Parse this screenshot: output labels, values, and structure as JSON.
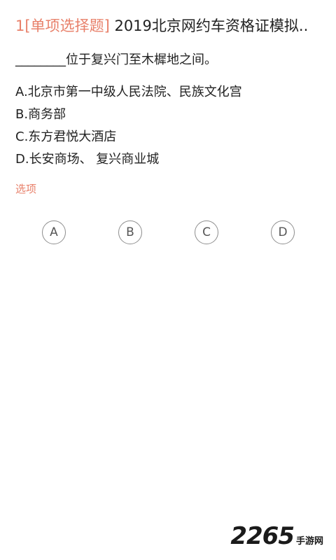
{
  "header": {
    "number": "1",
    "type": "[单项选择题]",
    "title": "2019北京网约车资格证模拟.."
  },
  "question": {
    "text": "________位于复兴门至木樨地之间。"
  },
  "options": [
    {
      "text": "A.北京市第一中级人民法院、民族文化宫"
    },
    {
      "text": "B.商务部"
    },
    {
      "text": "C.东方君悦大酒店"
    },
    {
      "text": "D.长安商场、 复兴商业城"
    }
  ],
  "choice_label": "选项",
  "choices": [
    "A",
    "B",
    "C",
    "D"
  ],
  "watermark": {
    "number": "2265",
    "text": "手游网"
  },
  "colors": {
    "accent": "#e8806a",
    "text": "#222222",
    "circle_border": "#8e8e8e"
  }
}
